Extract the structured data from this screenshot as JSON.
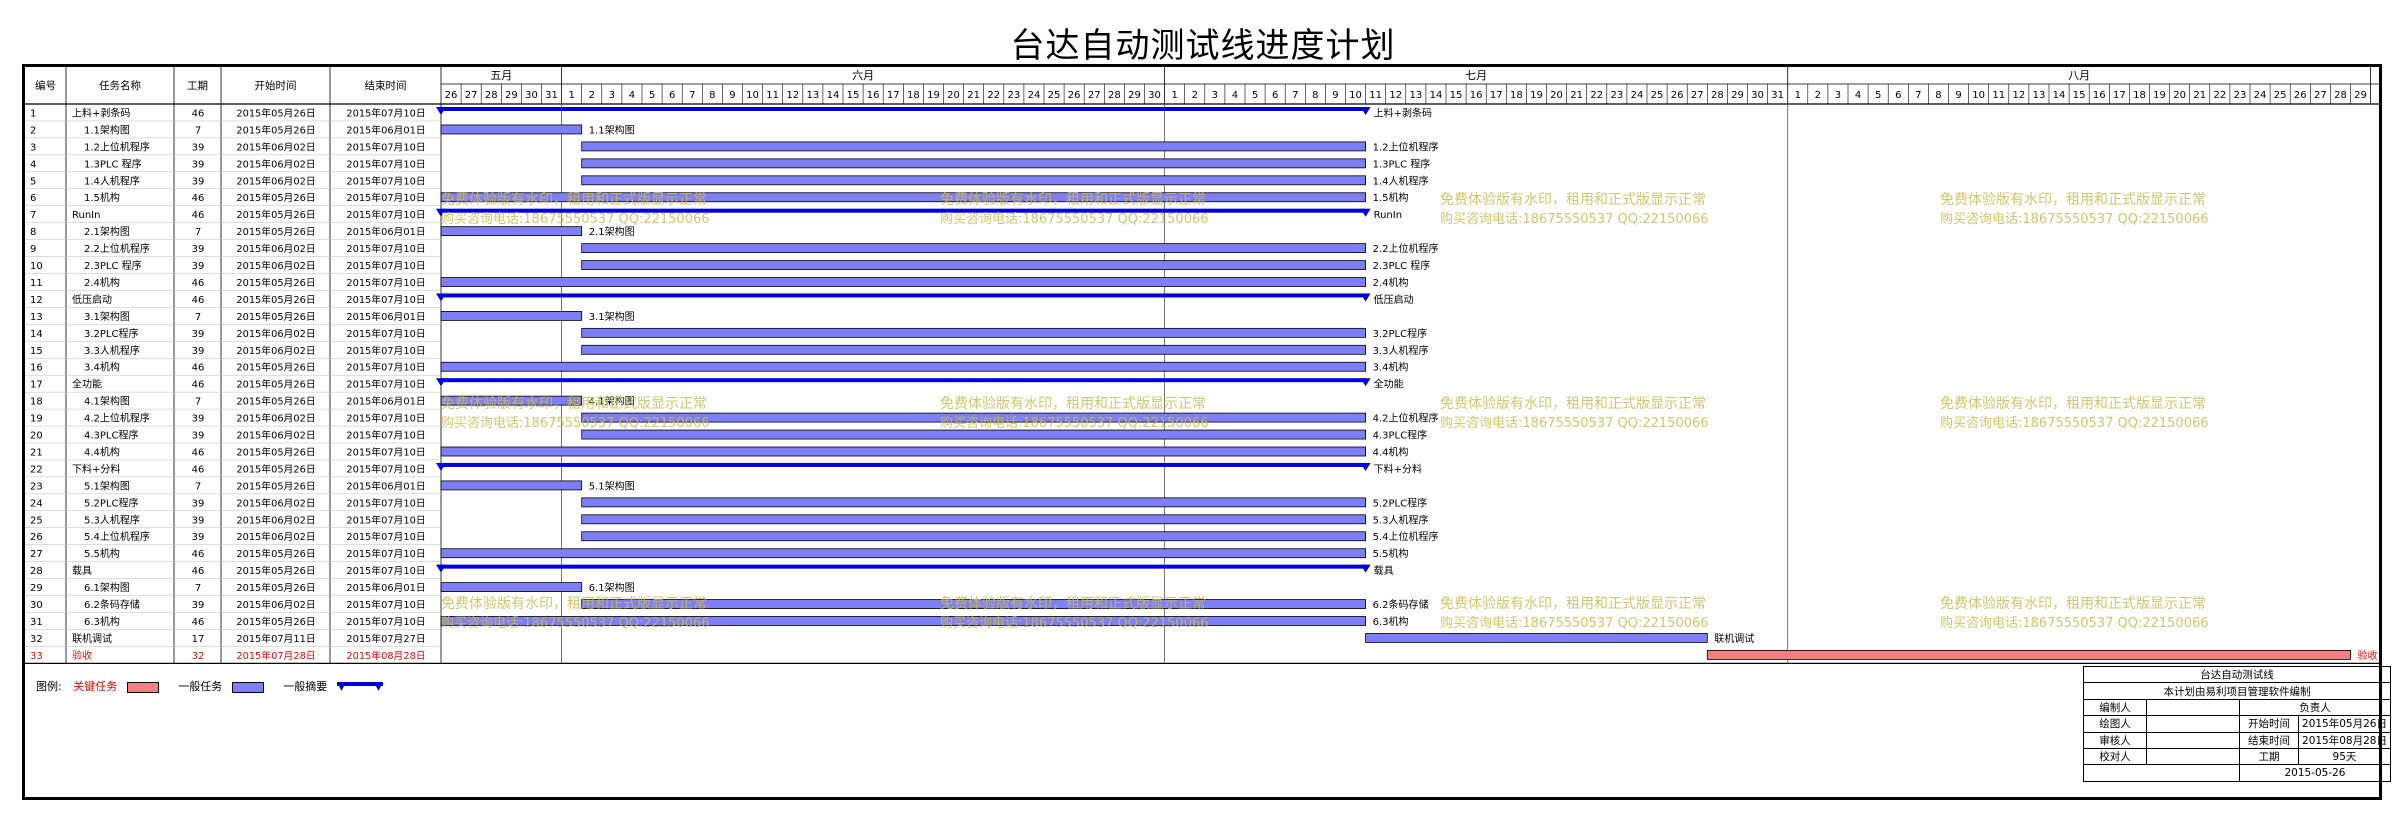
{
  "title": "台达自动测试线进度计划",
  "columns": {
    "num": "编号",
    "name": "任务名称",
    "dur": "工期",
    "start": "开始时间",
    "end": "结束时间"
  },
  "months": [
    {
      "label": "五月",
      "days": [
        26,
        27,
        28,
        29,
        30,
        31
      ]
    },
    {
      "label": "六月",
      "days": [
        1,
        2,
        3,
        4,
        5,
        6,
        7,
        8,
        9,
        10,
        11,
        12,
        13,
        14,
        15,
        16,
        17,
        18,
        19,
        20,
        21,
        22,
        23,
        24,
        25,
        26,
        27,
        28,
        29,
        30
      ]
    },
    {
      "label": "七月",
      "days": [
        1,
        2,
        3,
        4,
        5,
        6,
        7,
        8,
        9,
        10,
        11,
        12,
        13,
        14,
        15,
        16,
        17,
        18,
        19,
        20,
        21,
        22,
        23,
        24,
        25,
        26,
        27,
        28,
        29,
        30,
        31
      ]
    },
    {
      "label": "八月",
      "days": [
        1,
        2,
        3,
        4,
        5,
        6,
        7,
        8,
        9,
        10,
        11,
        12,
        13,
        14,
        15,
        16,
        17,
        18,
        19,
        20,
        21,
        22,
        23,
        24,
        25,
        26,
        27,
        28,
        29
      ]
    }
  ],
  "tasks": [
    {
      "num": "1",
      "name": "上料+剥条码",
      "level": 0,
      "dur": "46",
      "start": "2015年05月26日",
      "end": "2015年07月10日",
      "type": "summary",
      "s": 0,
      "e": 46,
      "label": "上料+剥条码"
    },
    {
      "num": "2",
      "name": "1.1架构图",
      "level": 1,
      "dur": "7",
      "start": "2015年05月26日",
      "end": "2015年06月01日",
      "type": "task",
      "s": 0,
      "e": 7,
      "label": "1.1架构图"
    },
    {
      "num": "3",
      "name": "1.2上位机程序",
      "level": 1,
      "dur": "39",
      "start": "2015年06月02日",
      "end": "2015年07月10日",
      "type": "task",
      "s": 7,
      "e": 46,
      "label": "1.2上位机程序"
    },
    {
      "num": "4",
      "name": "1.3PLC 程序",
      "level": 1,
      "dur": "39",
      "start": "2015年06月02日",
      "end": "2015年07月10日",
      "type": "task",
      "s": 7,
      "e": 46,
      "label": "1.3PLC 程序"
    },
    {
      "num": "5",
      "name": "1.4人机程序",
      "level": 1,
      "dur": "39",
      "start": "2015年06月02日",
      "end": "2015年07月10日",
      "type": "task",
      "s": 7,
      "e": 46,
      "label": "1.4人机程序"
    },
    {
      "num": "6",
      "name": "1.5机构",
      "level": 1,
      "dur": "46",
      "start": "2015年05月26日",
      "end": "2015年07月10日",
      "type": "task",
      "s": 0,
      "e": 46,
      "label": "1.5机构"
    },
    {
      "num": "7",
      "name": "RunIn",
      "level": 0,
      "dur": "46",
      "start": "2015年05月26日",
      "end": "2015年07月10日",
      "type": "summary",
      "s": 0,
      "e": 46,
      "label": "RunIn"
    },
    {
      "num": "8",
      "name": "2.1架构图",
      "level": 1,
      "dur": "7",
      "start": "2015年05月26日",
      "end": "2015年06月01日",
      "type": "task",
      "s": 0,
      "e": 7,
      "label": "2.1架构图"
    },
    {
      "num": "9",
      "name": "2.2上位机程序",
      "level": 1,
      "dur": "39",
      "start": "2015年06月02日",
      "end": "2015年07月10日",
      "type": "task",
      "s": 7,
      "e": 46,
      "label": "2.2上位机程序"
    },
    {
      "num": "10",
      "name": "2.3PLC 程序",
      "level": 1,
      "dur": "39",
      "start": "2015年06月02日",
      "end": "2015年07月10日",
      "type": "task",
      "s": 7,
      "e": 46,
      "label": "2.3PLC 程序"
    },
    {
      "num": "11",
      "name": "2.4机构",
      "level": 1,
      "dur": "46",
      "start": "2015年05月26日",
      "end": "2015年07月10日",
      "type": "task",
      "s": 0,
      "e": 46,
      "label": "2.4机构"
    },
    {
      "num": "12",
      "name": "低压启动",
      "level": 0,
      "dur": "46",
      "start": "2015年05月26日",
      "end": "2015年07月10日",
      "type": "summary",
      "s": 0,
      "e": 46,
      "label": "低压启动"
    },
    {
      "num": "13",
      "name": "3.1架构图",
      "level": 1,
      "dur": "7",
      "start": "2015年05月26日",
      "end": "2015年06月01日",
      "type": "task",
      "s": 0,
      "e": 7,
      "label": "3.1架构图"
    },
    {
      "num": "14",
      "name": "3.2PLC程序",
      "level": 1,
      "dur": "39",
      "start": "2015年06月02日",
      "end": "2015年07月10日",
      "type": "task",
      "s": 7,
      "e": 46,
      "label": "3.2PLC程序"
    },
    {
      "num": "15",
      "name": "3.3人机程序",
      "level": 1,
      "dur": "39",
      "start": "2015年06月02日",
      "end": "2015年07月10日",
      "type": "task",
      "s": 7,
      "e": 46,
      "label": "3.3人机程序"
    },
    {
      "num": "16",
      "name": "3.4机构",
      "level": 1,
      "dur": "46",
      "start": "2015年05月26日",
      "end": "2015年07月10日",
      "type": "task",
      "s": 0,
      "e": 46,
      "label": "3.4机构"
    },
    {
      "num": "17",
      "name": "全功能",
      "level": 0,
      "dur": "46",
      "start": "2015年05月26日",
      "end": "2015年07月10日",
      "type": "summary",
      "s": 0,
      "e": 46,
      "label": "全功能"
    },
    {
      "num": "18",
      "name": "4.1架构图",
      "level": 1,
      "dur": "7",
      "start": "2015年05月26日",
      "end": "2015年06月01日",
      "type": "task",
      "s": 0,
      "e": 7,
      "label": "4.1架构图"
    },
    {
      "num": "19",
      "name": "4.2上位机程序",
      "level": 1,
      "dur": "39",
      "start": "2015年06月02日",
      "end": "2015年07月10日",
      "type": "task",
      "s": 7,
      "e": 46,
      "label": "4.2上位机程序"
    },
    {
      "num": "20",
      "name": "4.3PLC程序",
      "level": 1,
      "dur": "39",
      "start": "2015年06月02日",
      "end": "2015年07月10日",
      "type": "task",
      "s": 7,
      "e": 46,
      "label": "4.3PLC程序"
    },
    {
      "num": "21",
      "name": "4.4机构",
      "level": 1,
      "dur": "46",
      "start": "2015年05月26日",
      "end": "2015年07月10日",
      "type": "task",
      "s": 0,
      "e": 46,
      "label": "4.4机构"
    },
    {
      "num": "22",
      "name": "下料+分料",
      "level": 0,
      "dur": "46",
      "start": "2015年05月26日",
      "end": "2015年07月10日",
      "type": "summary",
      "s": 0,
      "e": 46,
      "label": "下料+分料"
    },
    {
      "num": "23",
      "name": "5.1架构图",
      "level": 1,
      "dur": "7",
      "start": "2015年05月26日",
      "end": "2015年06月01日",
      "type": "task",
      "s": 0,
      "e": 7,
      "label": "5.1架构图"
    },
    {
      "num": "24",
      "name": "5.2PLC程序",
      "level": 1,
      "dur": "39",
      "start": "2015年06月02日",
      "end": "2015年07月10日",
      "type": "task",
      "s": 7,
      "e": 46,
      "label": "5.2PLC程序"
    },
    {
      "num": "25",
      "name": "5.3人机程序",
      "level": 1,
      "dur": "39",
      "start": "2015年06月02日",
      "end": "2015年07月10日",
      "type": "task",
      "s": 7,
      "e": 46,
      "label": "5.3人机程序"
    },
    {
      "num": "26",
      "name": "5.4上位机程序",
      "level": 1,
      "dur": "39",
      "start": "2015年06月02日",
      "end": "2015年07月10日",
      "type": "task",
      "s": 7,
      "e": 46,
      "label": "5.4上位机程序"
    },
    {
      "num": "27",
      "name": "5.5机构",
      "level": 1,
      "dur": "46",
      "start": "2015年05月26日",
      "end": "2015年07月10日",
      "type": "task",
      "s": 0,
      "e": 46,
      "label": "5.5机构"
    },
    {
      "num": "28",
      "name": "载具",
      "level": 0,
      "dur": "46",
      "start": "2015年05月26日",
      "end": "2015年07月10日",
      "type": "summary",
      "s": 0,
      "e": 46,
      "label": "载具"
    },
    {
      "num": "29",
      "name": "6.1架构图",
      "level": 1,
      "dur": "7",
      "start": "2015年05月26日",
      "end": "2015年06月01日",
      "type": "task",
      "s": 0,
      "e": 7,
      "label": "6.1架构图"
    },
    {
      "num": "30",
      "name": "6.2条码存储",
      "level": 1,
      "dur": "39",
      "start": "2015年06月02日",
      "end": "2015年07月10日",
      "type": "task",
      "s": 7,
      "e": 46,
      "label": "6.2条码存储"
    },
    {
      "num": "31",
      "name": "6.3机构",
      "level": 1,
      "dur": "46",
      "start": "2015年05月26日",
      "end": "2015年07月10日",
      "type": "task",
      "s": 0,
      "e": 46,
      "label": "6.3机构"
    },
    {
      "num": "32",
      "name": "联机调试",
      "level": 0,
      "dur": "17",
      "start": "2015年07月11日",
      "end": "2015年07月27日",
      "type": "task",
      "s": 46,
      "e": 63,
      "label": "联机调试"
    },
    {
      "num": "33",
      "name": "验收",
      "level": 0,
      "dur": "32",
      "start": "2015年07月28日",
      "end": "2015年08月28日",
      "type": "critical",
      "s": 63,
      "e": 95,
      "label": "验收"
    }
  ],
  "watermark": {
    "line1": "免费体验版有水印，租用和正式版显示正常",
    "line2": "购买咨询电话:18675550537 QQ:22150066"
  },
  "legend": {
    "prefix": "图例:",
    "critical": "关键任务",
    "normal": "一般任务",
    "summary": "一般摘要"
  },
  "info": {
    "project": "台达自动测试线",
    "software": "本计划由易利项目管理软件编制",
    "editor": "编制人",
    "owner": "负责人",
    "drawer": "绘图人",
    "reviewer": "审核人",
    "checker": "校对人",
    "start_label": "开始时间",
    "start": "2015年05月26日",
    "end_label": "结束时间",
    "end": "2015年08月28日",
    "dur_label": "工期",
    "dur": "95天",
    "date": "2015-05-26"
  },
  "colors": {
    "task": "#7F7FF5",
    "critical": "#F28080",
    "summary": "#0000DD",
    "watermark": "#C9BC52",
    "critical_text": "#FF0000"
  }
}
